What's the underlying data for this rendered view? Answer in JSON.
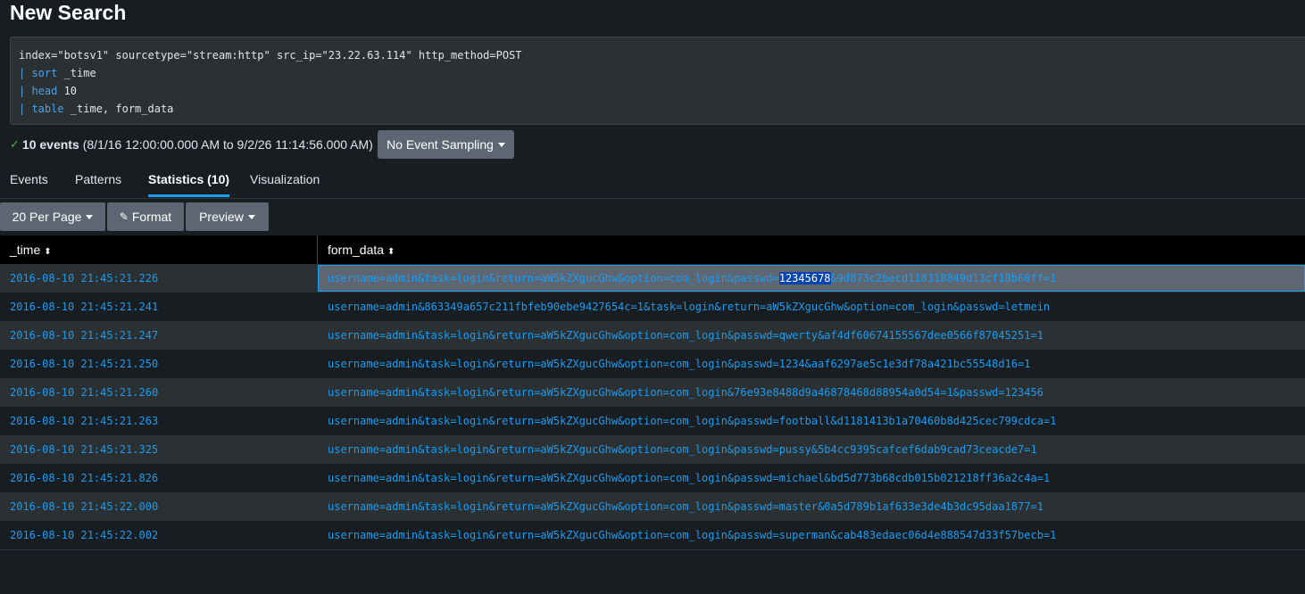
{
  "page": {
    "title": "New Search"
  },
  "search": {
    "line1": "index=\"botsv1\" sourcetype=\"stream:http\" src_ip=\"23.22.63.114\" http_method=POST",
    "line2_cmd": "sort",
    "line2_arg": " _time",
    "line3_cmd": "head",
    "line3_arg": " 10",
    "line4_cmd": "table",
    "line4_arg": " _time, form_data",
    "pipe": "| "
  },
  "status": {
    "count": "10 events",
    "range": "(8/1/16 12:00:00.000 AM to 9/2/26 11:14:56.000 AM)",
    "sampling_label": "No Event Sampling"
  },
  "tabs": [
    {
      "label": "Events"
    },
    {
      "label": "Patterns"
    },
    {
      "label": "Statistics (10)"
    },
    {
      "label": "Visualization"
    }
  ],
  "toolbar": {
    "per_page": "20 Per Page",
    "format": "Format",
    "preview": "Preview"
  },
  "table": {
    "columns": [
      "_time",
      "form_data"
    ],
    "selected_prefix": "username=admin&task=login&return=aW5kZXgucGhw&option=com_login&passwd=",
    "selected_highlight": "12345678",
    "selected_suffix": "&9d873c2becd118318849d13cf18b60ff=1",
    "rows": [
      {
        "time": "2016-08-10 21:45:21.226",
        "form": "username=admin&task=login&return=aW5kZXgucGhw&option=com_login&passwd=12345678&9d873c2becd118318849d13cf18b60ff=1"
      },
      {
        "time": "2016-08-10 21:45:21.241",
        "form": "username=admin&863349a657c211fbfeb90ebe9427654c=1&task=login&return=aW5kZXgucGhw&option=com_login&passwd=letmein"
      },
      {
        "time": "2016-08-10 21:45:21.247",
        "form": "username=admin&task=login&return=aW5kZXgucGhw&option=com_login&passwd=qwerty&af4df60674155567dee0566f87045251=1"
      },
      {
        "time": "2016-08-10 21:45:21.250",
        "form": "username=admin&task=login&return=aW5kZXgucGhw&option=com_login&passwd=1234&aaf6297ae5c1e3df78a421bc55548d16=1"
      },
      {
        "time": "2016-08-10 21:45:21.260",
        "form": "username=admin&task=login&return=aW5kZXgucGhw&option=com_login&76e93e8488d9a46878468d88954a0d54=1&passwd=123456"
      },
      {
        "time": "2016-08-10 21:45:21.263",
        "form": "username=admin&task=login&return=aW5kZXgucGhw&option=com_login&passwd=football&d1181413b1a70460b8d425cec799cdca=1"
      },
      {
        "time": "2016-08-10 21:45:21.325",
        "form": "username=admin&task=login&return=aW5kZXgucGhw&option=com_login&passwd=pussy&5b4cc9395cafcef6dab9cad73ceacde7=1"
      },
      {
        "time": "2016-08-10 21:45:21.826",
        "form": "username=admin&task=login&return=aW5kZXgucGhw&option=com_login&passwd=michael&bd5d773b68cdb015b021218ff36a2c4a=1"
      },
      {
        "time": "2016-08-10 21:45:22.000",
        "form": "username=admin&task=login&return=aW5kZXgucGhw&option=com_login&passwd=master&0a5d789b1af633e3de4b3dc95daa1877=1"
      },
      {
        "time": "2016-08-10 21:45:22.002",
        "form": "username=admin&task=login&return=aW5kZXgucGhw&option=com_login&passwd=superman&cab483edaec06d4e888547d33f57becb=1"
      }
    ]
  }
}
